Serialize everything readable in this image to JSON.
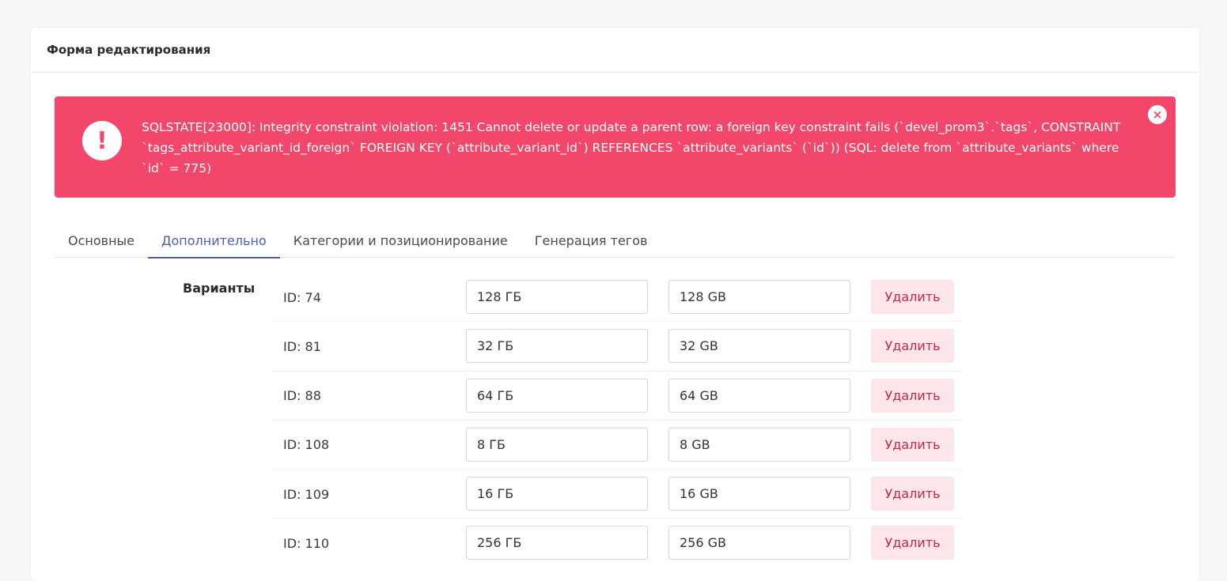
{
  "card": {
    "title": "Форма редактирования"
  },
  "alert": {
    "icon": "!",
    "close": "×",
    "message": "SQLSTATE[23000]: Integrity constraint violation: 1451 Cannot delete or update a parent row: a foreign key constraint fails (`devel_prom3`.`tags`, CONSTRAINT `tags_attribute_variant_id_foreign` FOREIGN KEY (`attribute_variant_id`) REFERENCES `attribute_variants` (`id`)) (SQL: delete from `attribute_variants` where `id` = 775)"
  },
  "tabs": [
    {
      "label": "Основные"
    },
    {
      "label": "Дополнительно"
    },
    {
      "label": "Категории и позиционирование"
    },
    {
      "label": "Генерация тегов"
    }
  ],
  "variants": {
    "label": "Варианты",
    "delete_label": "Удалить",
    "rows": [
      {
        "id": "ID: 74",
        "ru": "128 ГБ",
        "en": "128 GB"
      },
      {
        "id": "ID: 81",
        "ru": "32 ГБ",
        "en": "32 GB"
      },
      {
        "id": "ID: 88",
        "ru": "64 ГБ",
        "en": "64 GB"
      },
      {
        "id": "ID: 108",
        "ru": "8 ГБ",
        "en": "8 GB"
      },
      {
        "id": "ID: 109",
        "ru": "16 ГБ",
        "en": "16 GB"
      },
      {
        "id": "ID: 110",
        "ru": "256 ГБ",
        "en": "256 GB"
      }
    ]
  }
}
